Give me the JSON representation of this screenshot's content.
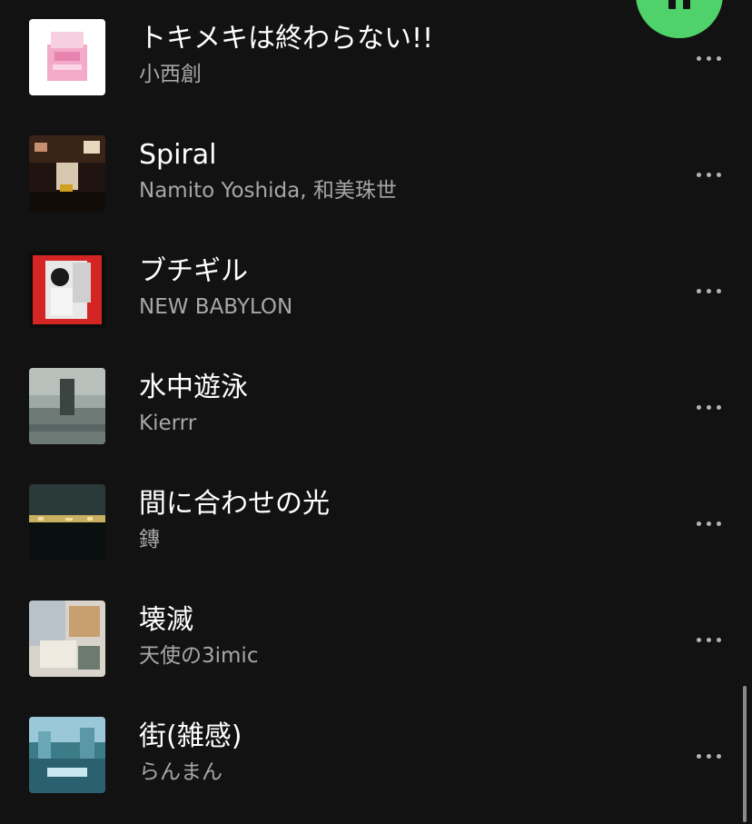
{
  "player": {
    "play_pause_state": "playing",
    "accent_color": "#4fd26a"
  },
  "tracks": [
    {
      "title": "トキメキは終わらない!!",
      "artist": "小西創"
    },
    {
      "title": "Spiral",
      "artist": "Namito Yoshida, 和美珠世"
    },
    {
      "title": "ブチギル",
      "artist": "NEW BABYLON"
    },
    {
      "title": "水中遊泳",
      "artist": "Kierrr"
    },
    {
      "title": "間に合わせの光",
      "artist": "鏄"
    },
    {
      "title": "壊滅",
      "artist": "天使の3imic"
    },
    {
      "title": "街(雑感)",
      "artist": "らんまん"
    }
  ],
  "icons": {
    "more": "more-options-icon",
    "pause": "pause-icon"
  },
  "colors": {
    "background": "#121212",
    "title_text": "#ffffff",
    "artist_text": "#a7a7a7"
  }
}
